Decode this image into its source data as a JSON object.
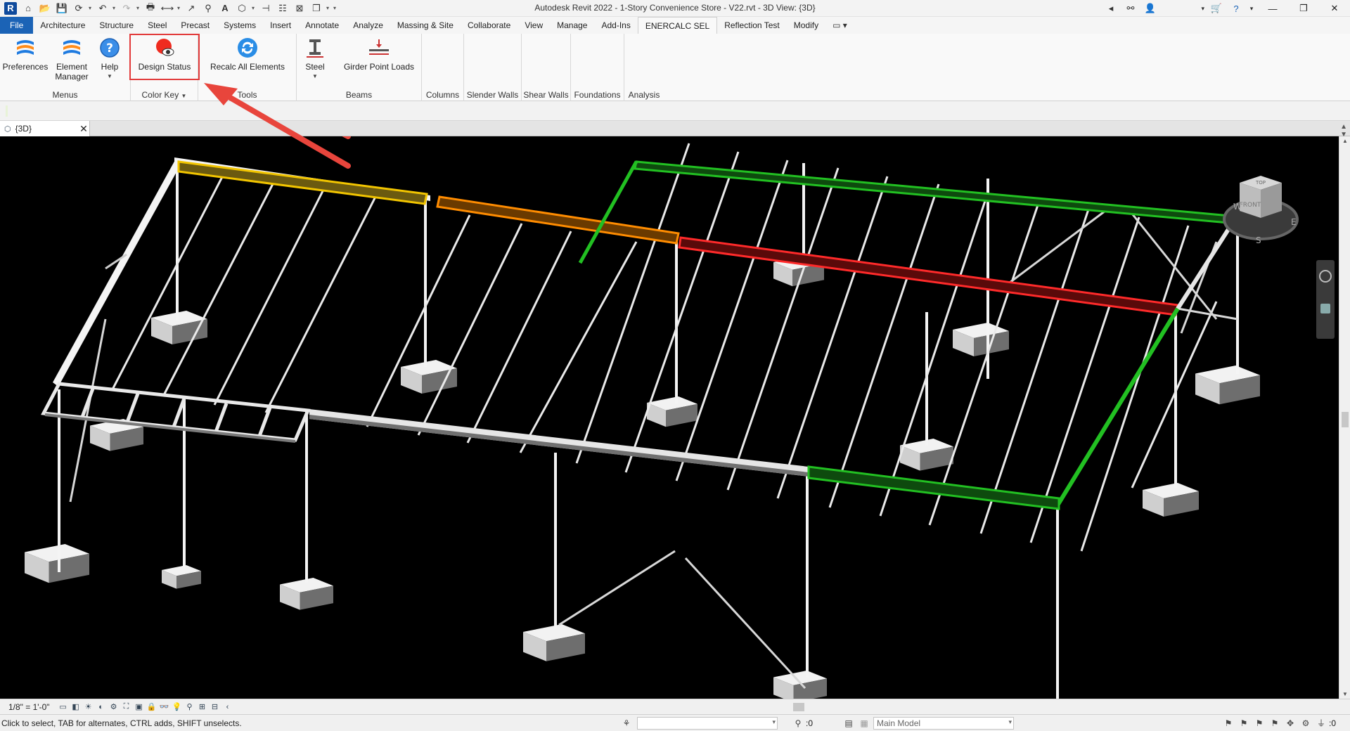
{
  "window": {
    "title": "Autodesk Revit 2022 - 1-Story Convenience Store - V22.rvt - 3D View: {3D}",
    "app_logo": "R"
  },
  "ribbon_tabs": [
    {
      "label": "File"
    },
    {
      "label": "Architecture"
    },
    {
      "label": "Structure"
    },
    {
      "label": "Steel"
    },
    {
      "label": "Precast"
    },
    {
      "label": "Systems"
    },
    {
      "label": "Insert"
    },
    {
      "label": "Annotate"
    },
    {
      "label": "Analyze"
    },
    {
      "label": "Massing & Site"
    },
    {
      "label": "Collaborate"
    },
    {
      "label": "View"
    },
    {
      "label": "Manage"
    },
    {
      "label": "Add-Ins"
    },
    {
      "label": "ENERCALC SEL"
    },
    {
      "label": "Reflection Test"
    },
    {
      "label": "Modify"
    }
  ],
  "ribbon": {
    "buttons": {
      "preferences": "Preferences",
      "element_manager_1": "Element",
      "element_manager_2": "Manager",
      "help": "Help",
      "design_status": "Design Status",
      "recalc_all": "Recalc All Elements",
      "steel": "Steel",
      "girder_point_loads": "Girder Point Loads"
    },
    "panels": {
      "menus": "Menus",
      "color_key": "Color Key",
      "tools": "Tools",
      "beams": "Beams",
      "columns": "Columns",
      "slender_walls": "Slender Walls",
      "shear_walls": "Shear Walls",
      "foundations": "Foundations",
      "analysis": "Analysis"
    }
  },
  "view_tab": {
    "label": "{3D}"
  },
  "viewcube": {
    "top": "TOP",
    "front": "FRONT",
    "w": "W",
    "s": "S",
    "e": "E"
  },
  "view_control": {
    "scale": "1/8\" = 1'-0\""
  },
  "status": {
    "message": "Click to select, TAB for alternates, CTRL adds, SHIFT unselects.",
    "workset_count": ":0",
    "model": "Main Model",
    "filter_count": ":0"
  },
  "colors": {
    "accent": "#1b63b6",
    "highlight": "#e23a3a",
    "pass": "#22c022",
    "fail": "#ff2a2a",
    "warn_orange": "#ff8c00",
    "warn_yellow": "#f2c500"
  }
}
